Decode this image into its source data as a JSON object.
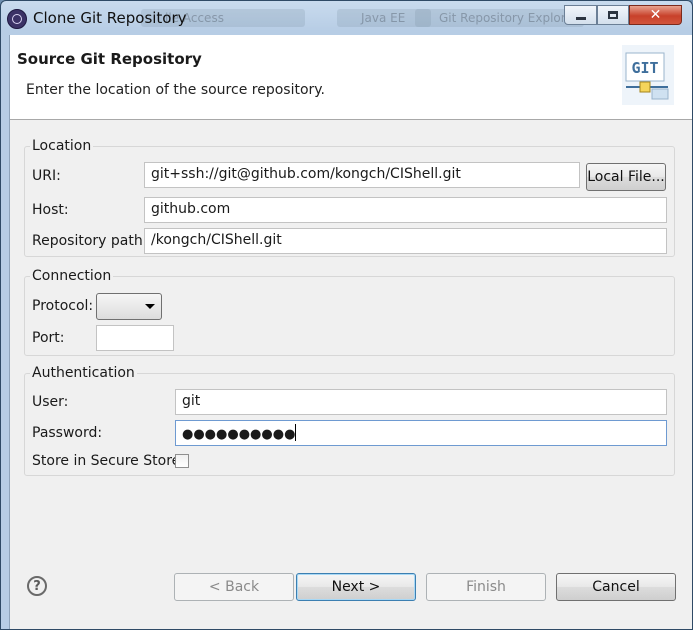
{
  "window": {
    "title": "Clone Git Repository",
    "background_tabs": [
      "ile Access",
      "Java EE",
      "Git Repository Explore"
    ]
  },
  "header": {
    "title": "Source Git Repository",
    "description": "Enter the location of the source repository.",
    "logo_text": "GIT"
  },
  "location": {
    "legend": "Location",
    "uri_label": "URI:",
    "uri_value": "git+ssh://git@github.com/kongch/CIShell.git",
    "local_file_button": "Local File...",
    "host_label": "Host:",
    "host_value": "github.com",
    "repo_path_label": "Repository path:",
    "repo_path_value": "/kongch/CIShell.git"
  },
  "connection": {
    "legend": "Connection",
    "protocol_label": "Protocol:",
    "protocol_value": "",
    "port_label": "Port:",
    "port_value": ""
  },
  "authentication": {
    "legend": "Authentication",
    "user_label": "User:",
    "user_value": "git",
    "password_label": "Password:",
    "password_masked": "●●●●●●●●●●",
    "secure_store_label": "Store in Secure Store",
    "secure_store_checked": false
  },
  "footer": {
    "back_button": "< Back",
    "next_button": "Next >",
    "finish_button": "Finish",
    "cancel_button": "Cancel"
  },
  "icons": {
    "help": "help-icon",
    "app": "eclipse-icon",
    "close": "close-icon",
    "maximize": "maximize-icon",
    "minimize": "minimize-icon"
  }
}
